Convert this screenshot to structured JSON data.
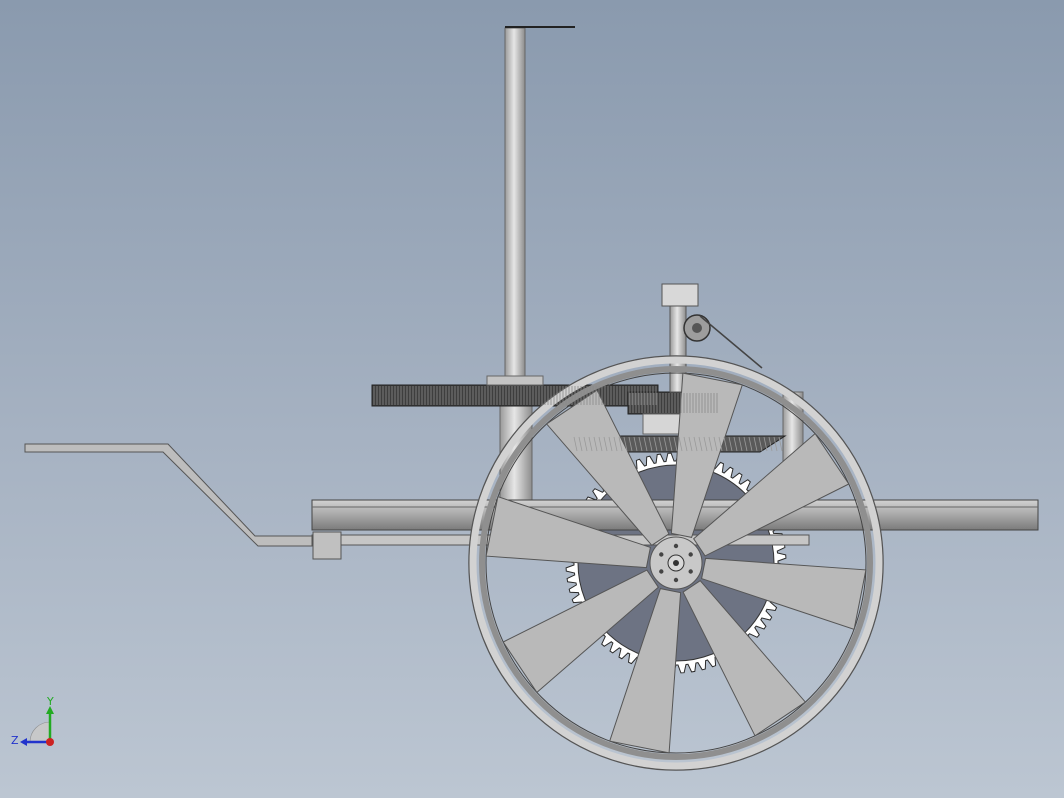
{
  "viewport": {
    "background_top": "#8a9aae",
    "background_bottom": "#bcc6d2"
  },
  "model": {
    "parts": [
      "vertical-post",
      "horizontal-spur-gear",
      "bevel-gear",
      "large-spur-gear",
      "spoked-wheel",
      "pulley",
      "bracket",
      "frame-rail",
      "handle"
    ],
    "spoke_count": 8,
    "part_color": "#b9b9b9",
    "gear_color": "#6d7383"
  },
  "triad": {
    "y_label": "Y",
    "z_label": "Z",
    "y_color": "#22aa22",
    "z_color": "#2233cc",
    "x_color": "#cc2222"
  }
}
